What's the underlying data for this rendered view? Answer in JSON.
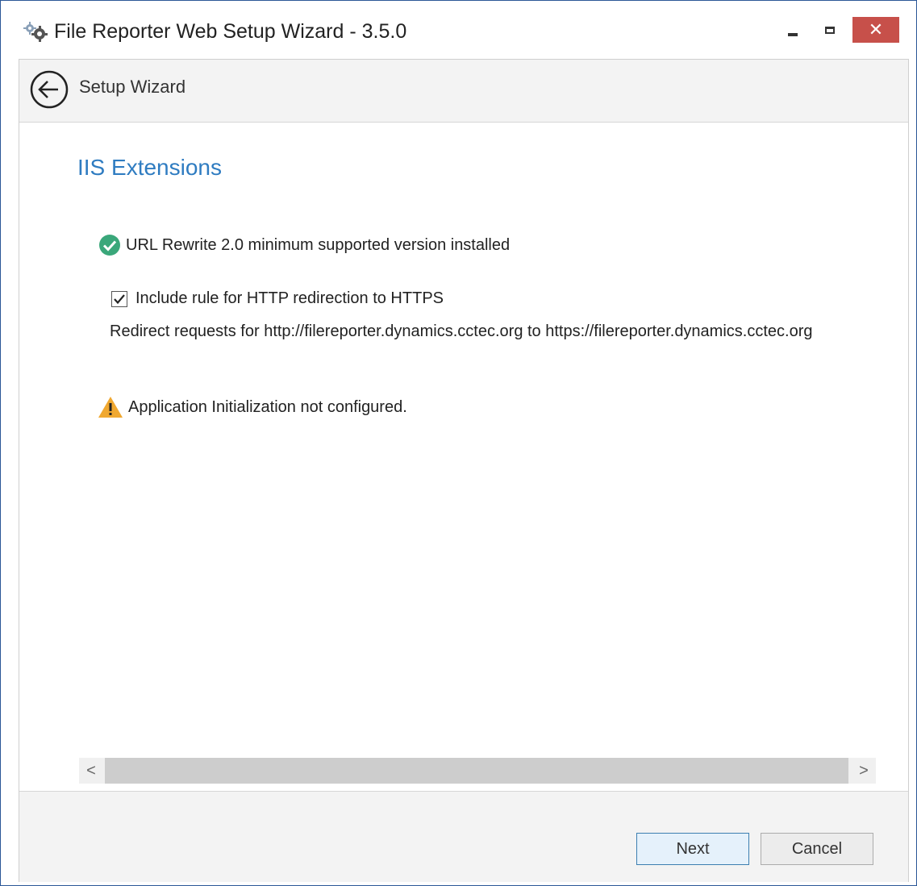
{
  "window": {
    "title": "File Reporter Web Setup Wizard - 3.5.0",
    "close_glyph": "✕"
  },
  "header": {
    "title": "Setup Wizard"
  },
  "content": {
    "page_title": "IIS Extensions",
    "url_rewrite_status": "URL Rewrite 2.0 minimum supported version installed",
    "https_rule_checkbox_label": "Include rule for HTTP redirection to HTTPS",
    "https_rule_checked": true,
    "redirect_description": "Redirect requests for http://filereporter.dynamics.cctec.org to https://filereporter.dynamics.cctec.org",
    "app_init_warning": "Application Initialization not configured."
  },
  "scrollbar": {
    "left_arrow": "<",
    "right_arrow": ">"
  },
  "footer": {
    "next_label": "Next",
    "cancel_label": "Cancel"
  },
  "icons": {
    "app": "gear-icon",
    "back": "back-arrow-icon",
    "ok": "check-circle-icon",
    "warning": "warning-triangle-icon",
    "check": "checkmark-icon"
  },
  "colors": {
    "accent": "#2f7cc1",
    "success": "#3aa77a",
    "warning": "#f0a830",
    "close": "#c7504a"
  }
}
